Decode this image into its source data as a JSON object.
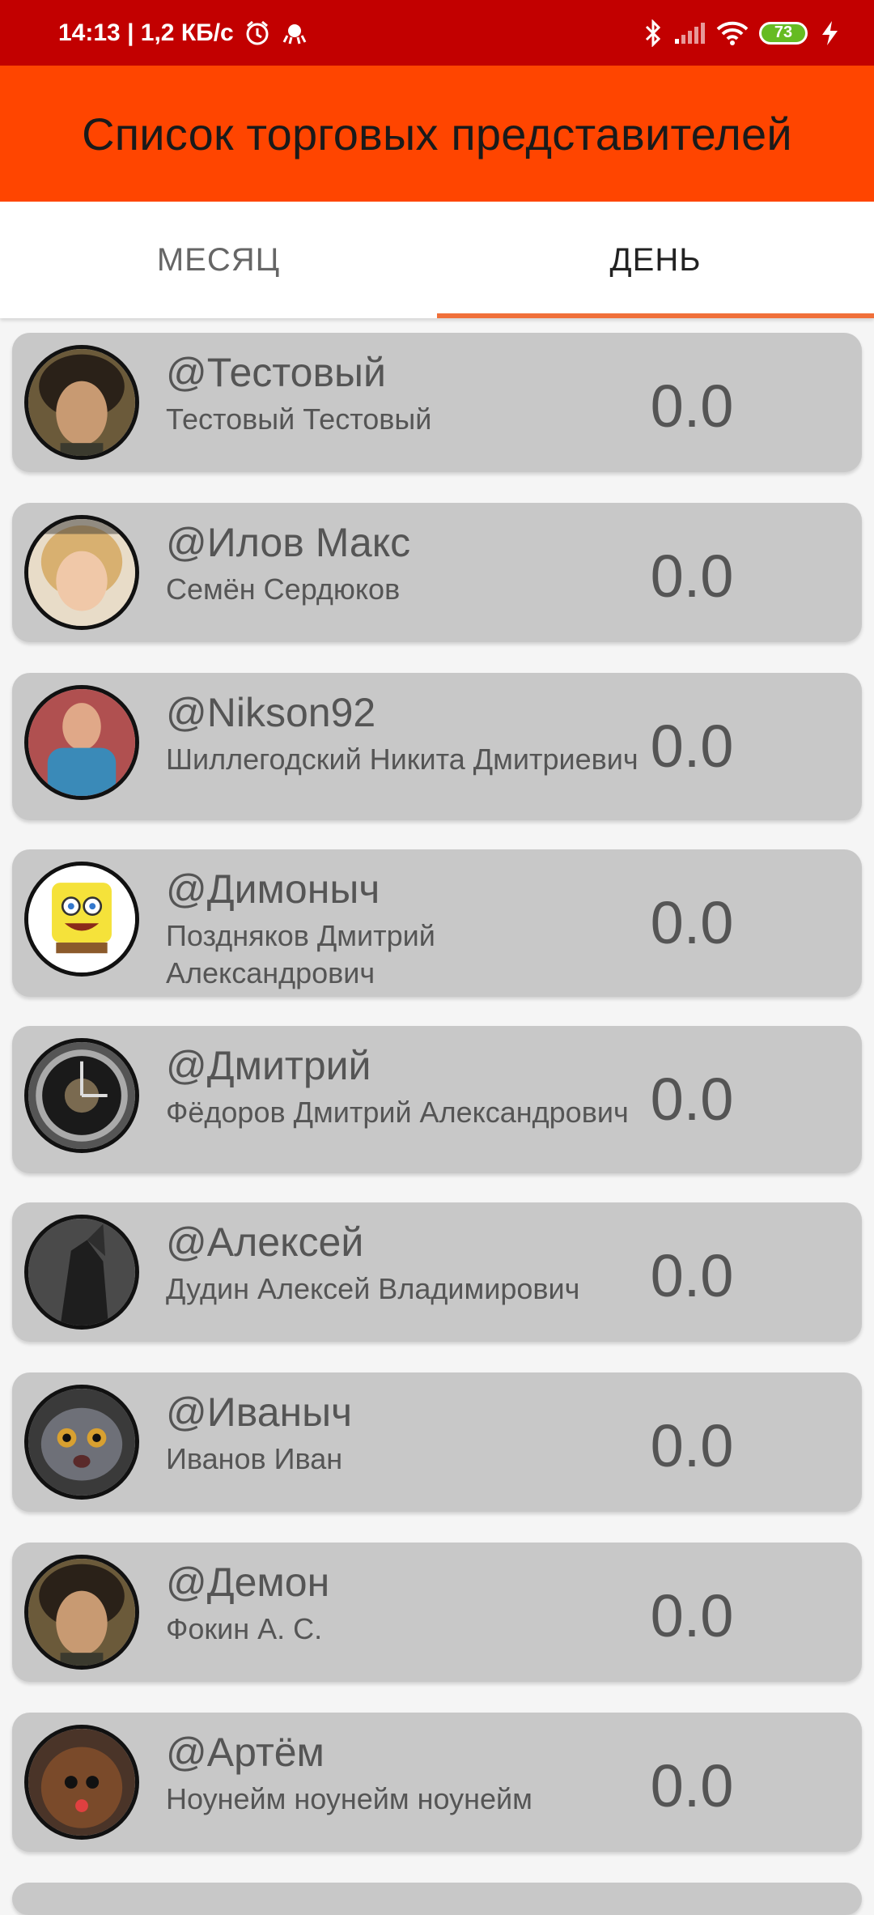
{
  "status_bar": {
    "time_speed": "14:13 | 1,2 КБ/с",
    "battery": "73",
    "icons": [
      "alarm-icon",
      "app-notification-icon",
      "bluetooth-icon",
      "signal-icon",
      "wifi-icon",
      "battery-icon",
      "charging-icon"
    ]
  },
  "app": {
    "title": "Список торговых представителей"
  },
  "tabs": {
    "month": "МЕСЯЦ",
    "day": "ДЕНЬ",
    "active": "day"
  },
  "accent_color": "#f0703a",
  "reps": [
    {
      "handle": "@Тестовый",
      "name": "Тестовый Тестовый",
      "score": "0.0"
    },
    {
      "handle": "@Илов Макс",
      "name": "Семён Сердюков",
      "score": "0.0"
    },
    {
      "handle": "@Nikson92",
      "name": "Шиллегодский Никита Дмитриевич",
      "score": "0.0"
    },
    {
      "handle": "@Димоныч",
      "name": "Поздняков Дмитрий Александрович",
      "score": "0.0"
    },
    {
      "handle": "@Дмитрий",
      "name": "Фёдоров Дмитрий Александрович",
      "score": "0.0"
    },
    {
      "handle": "@Алексей",
      "name": "Дудин Алексей Владимирович",
      "score": "0.0"
    },
    {
      "handle": "@Иваныч",
      "name": "Иванов Иван",
      "score": "0.0"
    },
    {
      "handle": "@Демон",
      "name": "Фокин А. С.",
      "score": "0.0"
    },
    {
      "handle": "@Артём",
      "name": "Ноунейм ноунейм ноунейм",
      "score": "0.0"
    }
  ]
}
